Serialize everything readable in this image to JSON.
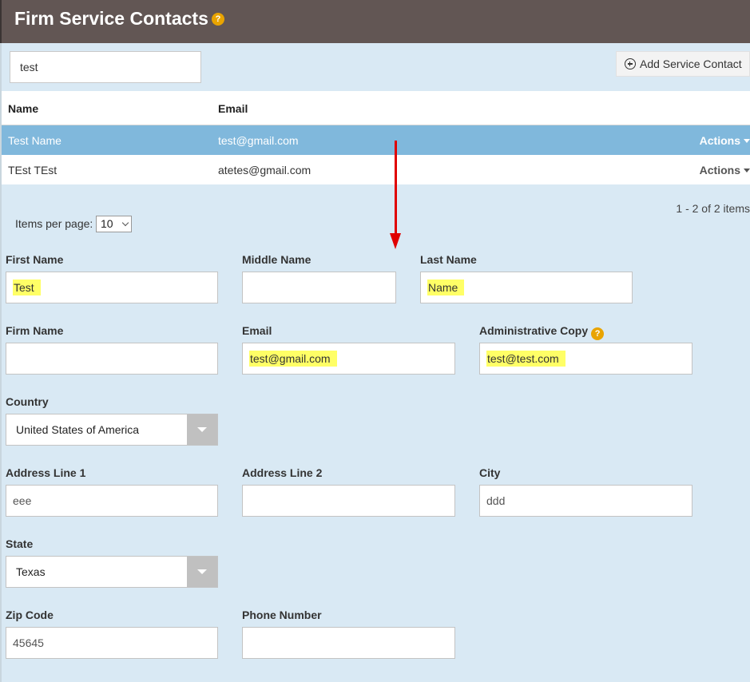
{
  "header": {
    "title": "Firm Service Contacts",
    "help": "?"
  },
  "search": {
    "value": "test"
  },
  "add_button": {
    "label": "Add Service Contact"
  },
  "grid": {
    "columns": [
      "Name",
      "Email"
    ],
    "rows": [
      {
        "name": "Test Name",
        "email": "test@gmail.com",
        "actions": "Actions"
      },
      {
        "name": "TEst TEst",
        "email": "atetes@gmail.com",
        "actions": "Actions"
      }
    ],
    "pager_info": "1 - 2 of 2 items",
    "items_per_page_label": "Items per page:",
    "items_per_page_value": "10"
  },
  "form": {
    "first_name": {
      "label": "First Name",
      "value": "Test"
    },
    "middle_name": {
      "label": "Middle Name",
      "value": ""
    },
    "last_name": {
      "label": "Last Name",
      "value": "Name"
    },
    "firm_name": {
      "label": "Firm Name",
      "value": ""
    },
    "email": {
      "label": "Email",
      "value": "test@gmail.com"
    },
    "admin_copy": {
      "label": "Administrative Copy",
      "value": "test@test.com"
    },
    "country": {
      "label": "Country",
      "value": "United States of America"
    },
    "address1": {
      "label": "Address Line 1",
      "value": "eee"
    },
    "address2": {
      "label": "Address Line 2",
      "value": ""
    },
    "city": {
      "label": "City",
      "value": "ddd"
    },
    "state": {
      "label": "State",
      "value": "Texas"
    },
    "zip": {
      "label": "Zip Code",
      "value": "45645"
    },
    "phone": {
      "label": "Phone Number",
      "value": ""
    }
  },
  "colors": {
    "header_bg": "#625654",
    "page_bg": "#d9e9f4",
    "selected_row": "#80b8dc",
    "highlight": "#ffff66",
    "annotation_arrow": "#e00000",
    "help_icon": "#e9a400"
  }
}
